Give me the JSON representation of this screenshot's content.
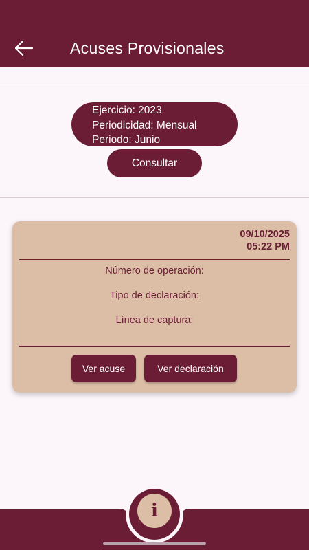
{
  "header": {
    "title": "Acuses Provisionales",
    "back_icon": "arrow-left-icon"
  },
  "query": {
    "ejercicio": "Ejercicio: 2023",
    "periodicidad": "Periodicidad: Mensual",
    "periodo": "Periodo: Junio",
    "consultar_label": "Consultar"
  },
  "card": {
    "date": "09/10/2025",
    "time": "05:22 PM",
    "numero_operacion": "Número de operación:",
    "tipo_declaracion": "Tipo de declaración:",
    "linea_captura": "Línea de captura:",
    "ver_acuse_label": "Ver acuse",
    "ver_declaracion_label": "Ver declaración"
  },
  "footer": {
    "info_glyph": "i",
    "info_icon": "info-icon"
  },
  "colors": {
    "primary": "#6b1d35",
    "card": "#dcbea6",
    "background": "#fcf6fb"
  }
}
